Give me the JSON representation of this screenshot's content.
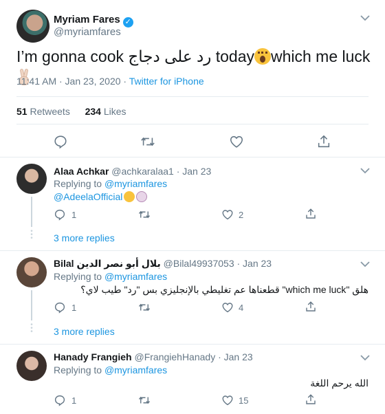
{
  "tweet": {
    "author_name": "Myriam Fares",
    "author_handle": "@myriamfares",
    "text_before": "I’m gonna cook ",
    "text_arabic": "رد على دجاج",
    "text_today": " today",
    "text_after": "which me luck ",
    "timestamp": "11:41 AM · Jan 23, 2020",
    "source_sep": " · ",
    "source": "Twitter for iPhone",
    "retweets_count": "51",
    "retweets_label": " Retweets",
    "likes_count": "234",
    "likes_label": " Likes"
  },
  "replies": [
    {
      "name": "Alaa Achkar",
      "meta": " @achkaralaa1 · Jan 23",
      "replying_prefix": "Replying to ",
      "replying_handle": "@myriamfares",
      "text": "@AdeelaOfficial",
      "replies_count": "1",
      "retweets_count": "",
      "likes_count": "2",
      "more_replies": "3 more replies"
    },
    {
      "name": "Bilal بلال أبو نصر الدين",
      "meta": " @Bilal49937053 · Jan 23",
      "replying_prefix": "Replying to ",
      "replying_handle": "@myriamfares",
      "text_line1": "هلق \"which me luck\" قطعناها عم تغليطي بالإنجليزي بس \"رد\" طيب لاي؟",
      "replies_count": "1",
      "retweets_count": "",
      "likes_count": "4",
      "more_replies": "3 more replies"
    },
    {
      "name": "Hanady Frangieh",
      "meta": " @FrangiehHanady · Jan 23",
      "replying_prefix": "Replying to ",
      "replying_handle": "@myriamfares",
      "text": "الله يرحم اللغة",
      "replies_count": "1",
      "retweets_count": "",
      "likes_count": "15"
    }
  ],
  "icons": {
    "reply": "reply-icon",
    "retweet": "retweet-icon",
    "like": "heart-icon",
    "share": "share-icon",
    "caret": "chevron-down-icon",
    "verified": "verified-badge-icon"
  },
  "colors": {
    "link": "#1b95e0",
    "muted": "#657786",
    "verified": "#1da1f2",
    "divider": "#e6ecf0"
  }
}
